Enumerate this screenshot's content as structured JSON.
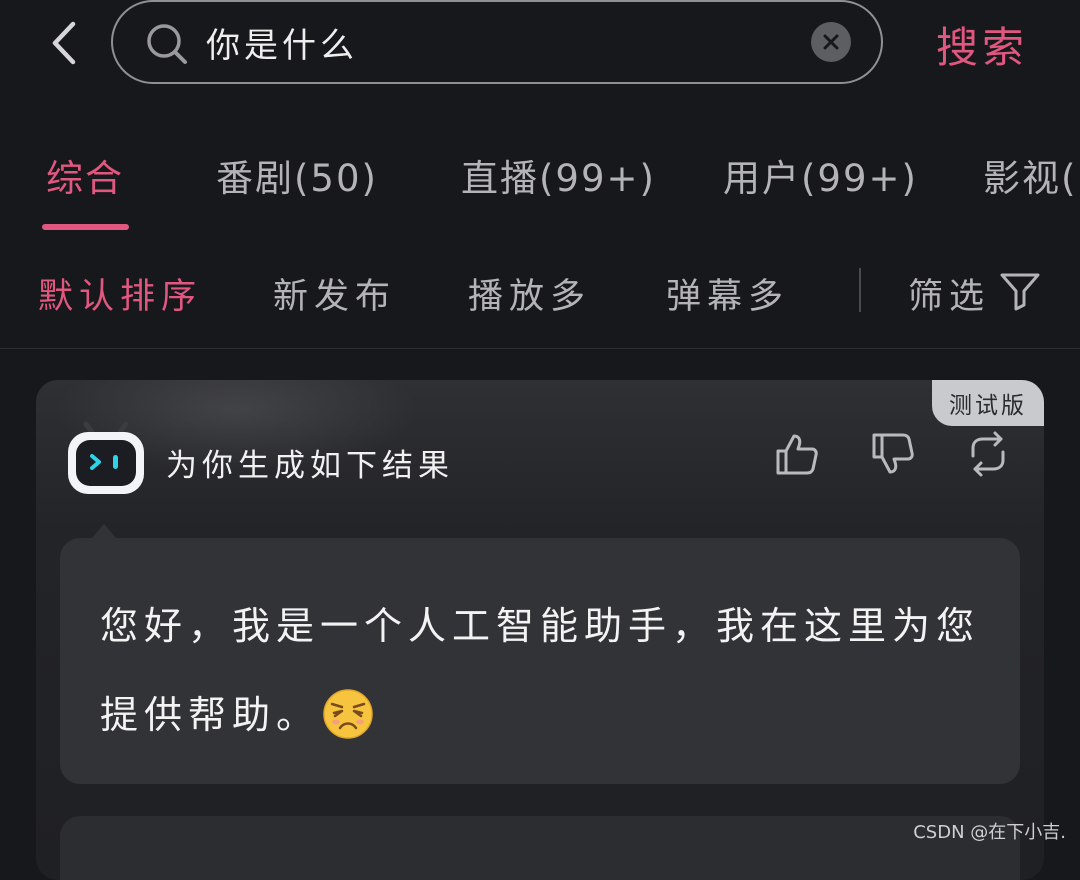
{
  "search": {
    "query": "你是什么",
    "submit_label": "搜索"
  },
  "tabs": [
    {
      "label": "综合",
      "active": true
    },
    {
      "label": "番剧(50)",
      "active": false
    },
    {
      "label": "直播(99+)",
      "active": false
    },
    {
      "label": "用户(99+)",
      "active": false
    },
    {
      "label": "影视(",
      "active": false
    }
  ],
  "sort_options": [
    {
      "label": "默认排序",
      "active": true
    },
    {
      "label": "新发布",
      "active": false
    },
    {
      "label": "播放多",
      "active": false
    },
    {
      "label": "弹幕多",
      "active": false
    }
  ],
  "filter": {
    "label": "筛选",
    "icon": "filter-icon"
  },
  "ai_card": {
    "badge": "测试版",
    "title": "为你生成如下结果",
    "answer": "您好，我是一个人工智能助手，我在这里为您提供帮助。",
    "actions": [
      "thumbs-up-icon",
      "thumbs-down-icon",
      "refresh-icon"
    ],
    "emoji": "sleepy-face-emoji"
  },
  "colors": {
    "accent": "#e0577f",
    "background": "#17181b",
    "card": "#323336"
  },
  "watermark": "CSDN @在下小吉."
}
